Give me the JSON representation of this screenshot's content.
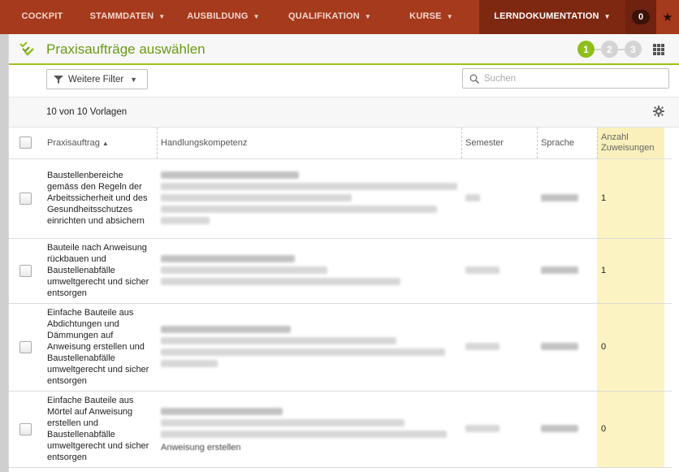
{
  "nav": {
    "items": [
      {
        "label": "COCKPIT",
        "caret": false,
        "active": false
      },
      {
        "label": "STAMMDATEN",
        "caret": true,
        "active": false
      },
      {
        "label": "AUSBILDUNG",
        "caret": true,
        "active": false
      },
      {
        "label": "QUALIFIKATION",
        "caret": true,
        "active": false
      },
      {
        "label": "KURSE",
        "caret": true,
        "active": false
      },
      {
        "label": "LERNDOKUMENTATION",
        "caret": true,
        "active": true
      }
    ],
    "badge": "0",
    "caret_glyph": "▼",
    "star_glyph": "★"
  },
  "header": {
    "title": "Praxisaufträge auswählen",
    "steps": [
      "1",
      "2",
      "3"
    ],
    "current_step": "1"
  },
  "toolbar": {
    "filter_label": "Weitere Filter",
    "search_placeholder": "Suchen"
  },
  "count_label": "10 von 10 Vorlagen",
  "table": {
    "columns": {
      "praxisauftrag": "Praxisauftrag",
      "handlungskompetenz": "Handlungskompetenz",
      "semester": "Semester",
      "sprache": "Sprache",
      "anzahl": "Anzahl Zuweisungen"
    },
    "sort_glyph": "▲",
    "rows": [
      {
        "praxisauftrag": "Baustellenbereiche gemäss den Regeln der Arbeitssicherheit und des Gesundheitsschutzes einrichten und absichern",
        "anzahl": "1",
        "blur_lines": 5,
        "residual": ""
      },
      {
        "praxisauftrag": "Bauteile nach Anweisung rückbauen und Baustellenabfälle umweltgerecht und sicher entsorgen",
        "anzahl": "1",
        "blur_lines": 3,
        "residual": ""
      },
      {
        "praxisauftrag": "Einfache Bauteile aus Abdichtungen und Dämmungen auf Anweisung erstellen und Baustellenabfälle umweltgerecht und sicher entsorgen",
        "anzahl": "0",
        "blur_lines": 4,
        "residual": ""
      },
      {
        "praxisauftrag": "Einfache Bauteile aus Mörtel auf Anweisung erstellen und Baustellenabfälle umweltgerecht und sicher entsorgen",
        "anzahl": "0",
        "blur_lines": 3,
        "residual": "Anweisung erstellen"
      }
    ]
  },
  "colors": {
    "nav_bg": "#a63a1c",
    "accent_green": "#8fbe1a",
    "highlight": "#fbf3c2"
  }
}
